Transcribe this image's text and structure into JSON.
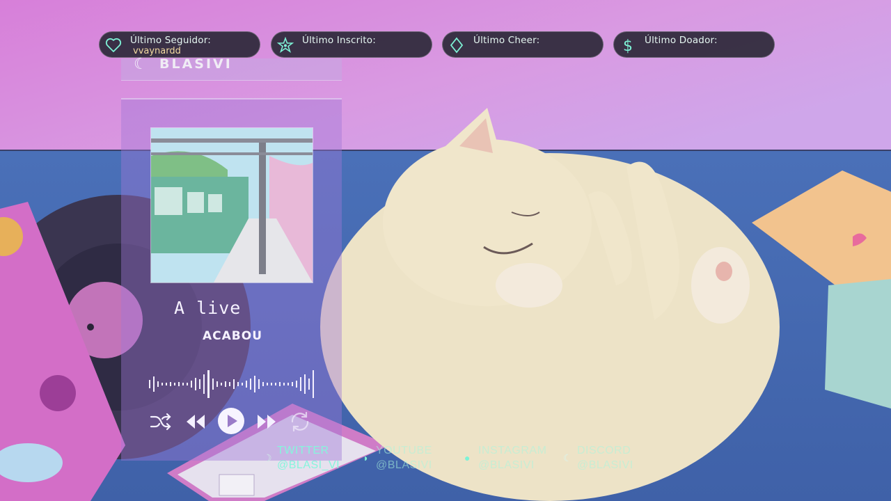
{
  "alerts": [
    {
      "icon": "heart-icon",
      "label": "Último Seguidor:",
      "value": "vvaynardd"
    },
    {
      "icon": "star-icon",
      "label": "Último Inscrito:",
      "value": ""
    },
    {
      "icon": "diamond-icon",
      "label": "Último Cheer:",
      "value": ""
    },
    {
      "icon": "dollar-icon",
      "label": "Último Doador:",
      "value": ""
    }
  ],
  "player": {
    "brand": "BLASIVI",
    "song_title": "A live",
    "artist": "ACABOU"
  },
  "socials": [
    {
      "network": "TWITTER",
      "handle": "@BLASI_VI"
    },
    {
      "network": "YOUTUBE",
      "handle": "@BLASIVI"
    },
    {
      "network": "INSTAGRAM",
      "handle": "@BLASIVI"
    },
    {
      "network": "DISCORD",
      "handle": "@BLASIVI"
    }
  ],
  "colors": {
    "accent": "#7ef2d6",
    "pill_bg": "#2c2838",
    "sky_top": "#d88ddf",
    "floor": "#4a6db3"
  }
}
